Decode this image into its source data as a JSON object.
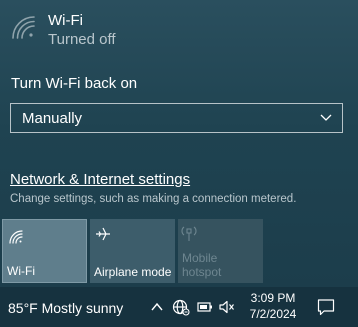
{
  "wifi": {
    "title": "Wi-Fi",
    "status": "Turned off",
    "icon": "wifi-signal-icon"
  },
  "turn_on": {
    "label": "Turn Wi-Fi back on",
    "selected": "Manually"
  },
  "settings": {
    "link": "Network & Internet settings",
    "description": "Change settings, such as making a connection metered."
  },
  "tiles": [
    {
      "label": "Wi-Fi",
      "icon": "wifi-icon",
      "state": "on"
    },
    {
      "label": "Airplane mode",
      "icon": "airplane-icon",
      "state": "off"
    },
    {
      "label": "Mobile hotspot",
      "icon": "hotspot-icon",
      "state": "disabled"
    }
  ],
  "taskbar": {
    "weather": "85°F  Mostly sunny",
    "time": "3:09 PM",
    "date": "7/2/2024"
  }
}
